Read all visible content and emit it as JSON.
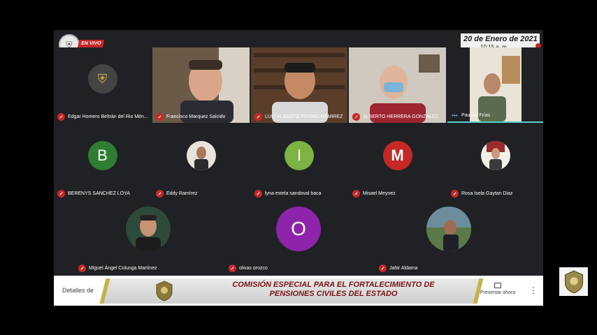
{
  "live_tag": "EN VIVO",
  "date": {
    "line1": "20 de Enero de 2021",
    "line2": "10:15 a. m."
  },
  "tiles": {
    "t1": "Edgar Homero Beltrán del Rio Mén...",
    "t2": "Francisco Marquez Salcido",
    "t3": "LUIS ALBERTO FIERRO RAMIREZ",
    "t4": "ALBERTO HERRERA GONZALEZ",
    "t5": "Paulina Frías",
    "t6": "BERENYS SANCHEZ LOYA",
    "t7": "Eddy Ramírez",
    "t8": "lyna estela sandoval baca",
    "t9": "Misael Meynez",
    "t10": "Rosa Isela Gaytan Diaz",
    "t11": "Miguel Ángel Colunga Martínez",
    "t12": "olivas orozco",
    "t13": "Jahir Aldama"
  },
  "letters": {
    "b": "B",
    "i": "I",
    "m": "M",
    "o": "O"
  },
  "colors": {
    "b": "#2e7d32",
    "i": "#7cb342",
    "m": "#c62828",
    "o": "#8e24aa",
    "accent": "#c9b14a"
  },
  "bottom": {
    "details": "Detalles de",
    "banner_line1": "COMISIÓN ESPECIAL PARA EL FORTALECIMIENTO DE",
    "banner_line2": "PENSIONES CIVILES DEL ESTADO",
    "present": "Presentar ahora",
    "more": "⋮"
  }
}
